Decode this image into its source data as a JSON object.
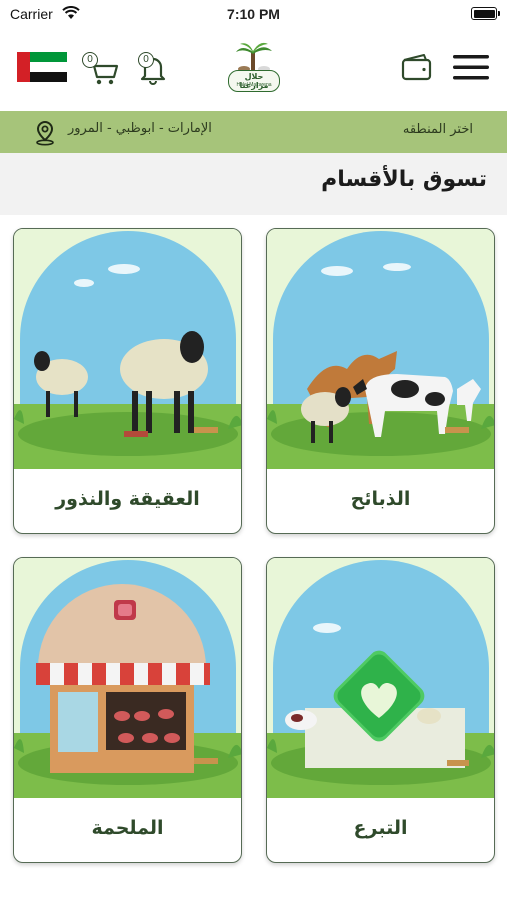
{
  "status_bar": {
    "carrier": "Carrier",
    "time": "7:10 PM"
  },
  "header": {
    "cart_count": "0",
    "notification_count": "0",
    "logo_ar": "حلال مزارعنا",
    "logo_en": "Halal Mazarena"
  },
  "location": {
    "choose_label": "اختر المنطقه",
    "selected_region": "الإمارات - ابوظبي - المرور"
  },
  "section_title": "تسوق بالأقسام",
  "categories": [
    {
      "label": "الذبائح"
    },
    {
      "label": "العقيقة والنذور"
    },
    {
      "label": "التبرع"
    },
    {
      "label": "الملحمة"
    }
  ],
  "colors": {
    "accent": "#a6c47a",
    "label_text": "#2f4a2b",
    "card_bg": "#e8f6d8"
  },
  "icons": [
    "wifi-icon",
    "battery-icon",
    "uae-flag-icon",
    "cart-icon",
    "bell-icon",
    "wallet-icon",
    "menu-icon",
    "location-pin-icon"
  ]
}
